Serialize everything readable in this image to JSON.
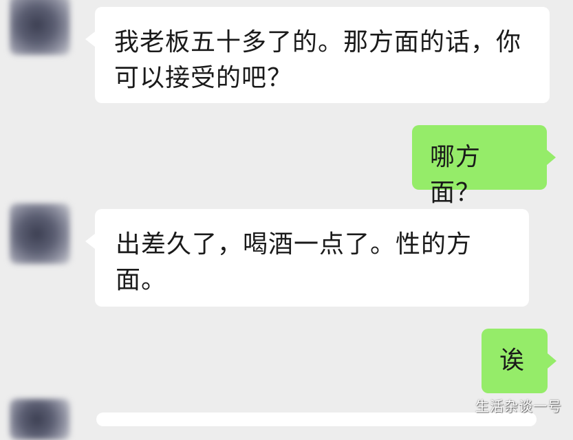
{
  "conversation": {
    "messages": [
      {
        "sender": "contact",
        "text": "我老板五十多了的。那方面的话，你可以接受的吧？"
      },
      {
        "sender": "self",
        "text": "哪方面？"
      },
      {
        "sender": "contact",
        "text": "出差久了，喝酒一点了。性的方面。"
      },
      {
        "sender": "self",
        "text": "诶"
      }
    ]
  },
  "watermark": {
    "text": "生活杂谈一号"
  },
  "colors": {
    "background": "#ededed",
    "incoming_bubble": "#ffffff",
    "outgoing_bubble": "#95ec69",
    "text": "#1a1a1a"
  }
}
